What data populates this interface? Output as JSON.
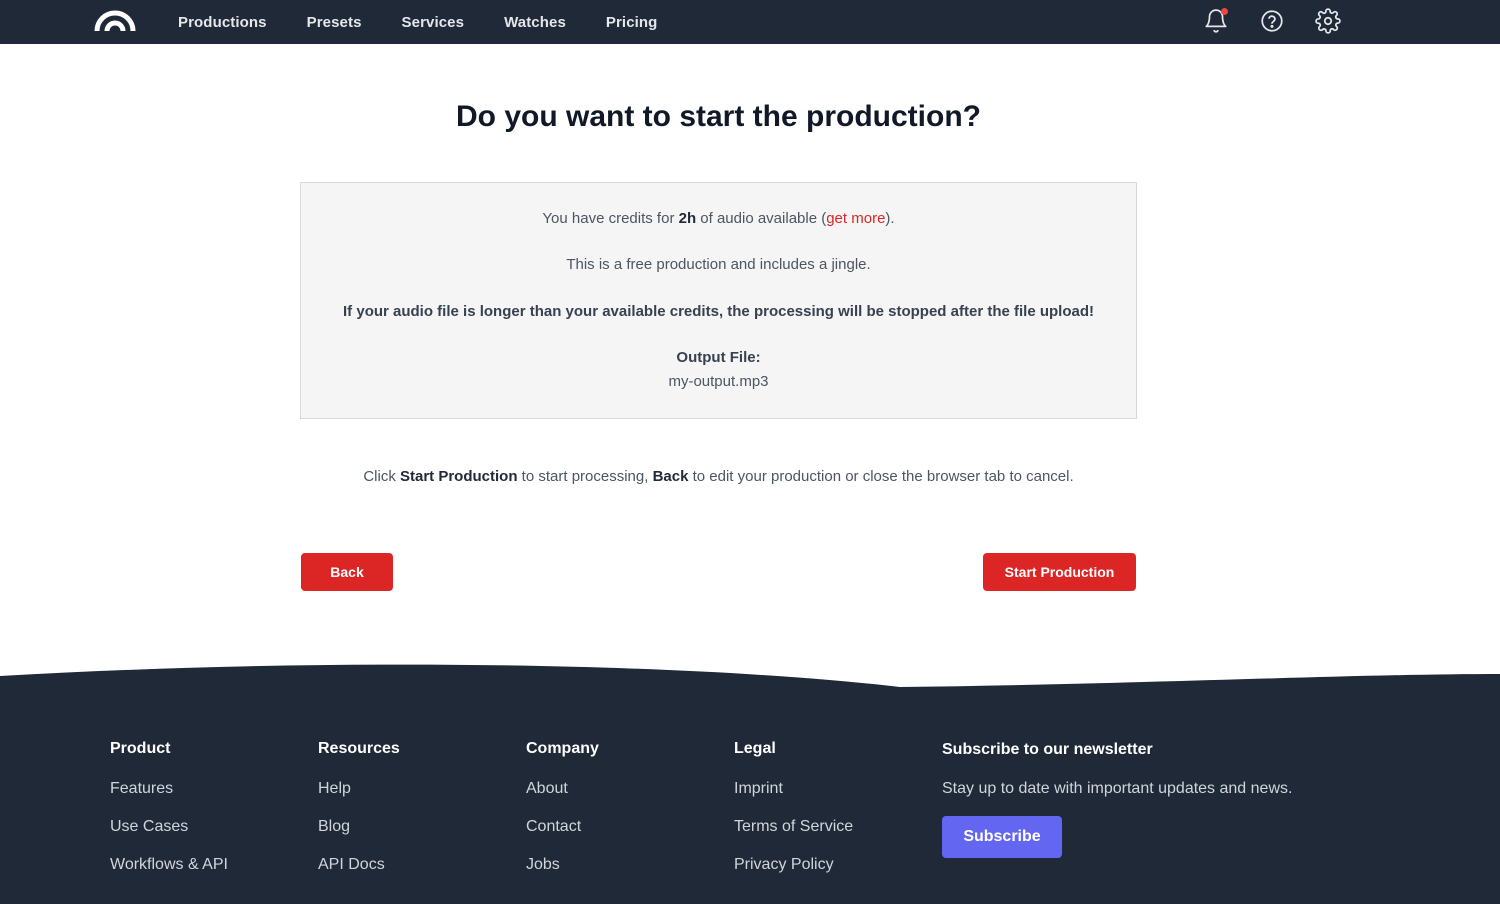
{
  "nav": {
    "links": [
      "Productions",
      "Presets",
      "Services",
      "Watches",
      "Pricing"
    ],
    "icons": [
      "bell-icon",
      "help-circle-icon",
      "gear-icon"
    ]
  },
  "main": {
    "title": "Do you want to start the production?",
    "info": {
      "credits_prefix": "You have credits for ",
      "credits_amount": "2h",
      "credits_mid": " of audio available (",
      "credits_link": "get more",
      "credits_suffix": ").",
      "free_note": "This is a free production and includes a jingle.",
      "warning": "If your audio file is longer than your available credits, the processing will be stopped after the file upload!",
      "output_label": "Output File:",
      "output_file": "my-output.mp3"
    },
    "hint": {
      "p1": "Click ",
      "b1": "Start Production",
      "p2": " to start processing, ",
      "b2": "Back",
      "p3": " to edit your production or close the browser tab to cancel."
    },
    "back_label": "Back",
    "start_label": "Start Production"
  },
  "footer": {
    "columns": [
      {
        "heading": "Product",
        "links": [
          "Features",
          "Use Cases",
          "Workflows & API"
        ]
      },
      {
        "heading": "Resources",
        "links": [
          "Help",
          "Blog",
          "API Docs"
        ]
      },
      {
        "heading": "Company",
        "links": [
          "About",
          "Contact",
          "Jobs"
        ]
      },
      {
        "heading": "Legal",
        "links": [
          "Imprint",
          "Terms of Service",
          "Privacy Policy"
        ]
      }
    ],
    "newsletter": {
      "heading": "Subscribe to our newsletter",
      "text": "Stay up to date with important updates and news.",
      "button": "Subscribe"
    }
  },
  "colors": {
    "nav_bg": "#1f2937",
    "accent_red": "#dc2626",
    "subscribe": "#6366f1",
    "info_bg": "#f5f5f5"
  }
}
